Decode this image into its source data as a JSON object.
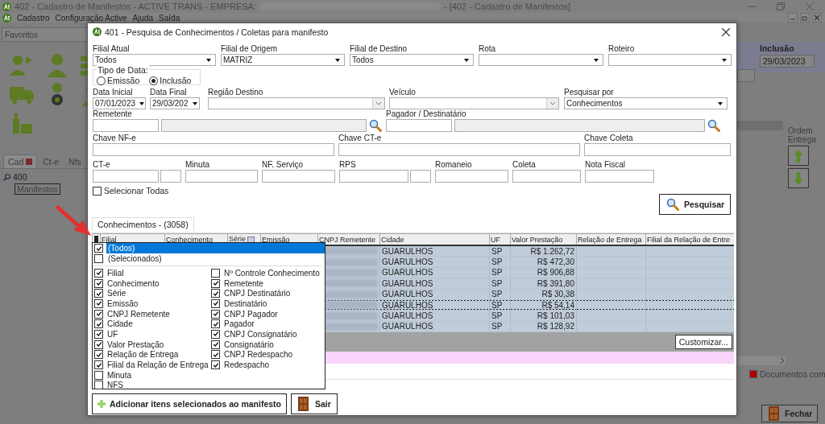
{
  "main_window": {
    "title": "402 - Cadastro de Manifestos - ACTIVE TRANS - EMPRESA:",
    "title_suffix": "- [402 - Cadastro de Manifestos]"
  },
  "menu": [
    "Cadastro",
    "Configuração Active",
    "Ajuda",
    "Saída"
  ],
  "favorites": "Favoritos",
  "side_tabs": [
    {
      "label": "Cad",
      "selected": true
    },
    {
      "label": "Ct-e",
      "selected": false
    },
    {
      "label": "Nfs",
      "selected": false
    }
  ],
  "tree_search": {
    "value": "400"
  },
  "tree": [
    {
      "label": "Manifestos",
      "selected": true
    }
  ],
  "inclusao": {
    "label": "Inclusão",
    "value": "29/03/2023"
  },
  "ordem_entrega": "Ordem Entrega",
  "legend": {
    "label": "Documentos com",
    "color": "#b00000"
  },
  "close_button": "Fechar",
  "dialog": {
    "title": "401 - Pesquisa de Conhecimentos / Coletas para manifesto",
    "selects": [
      {
        "label": "Filial Atual",
        "value": "Todos"
      },
      {
        "label": "Filial de Origem",
        "value": "MATRIZ"
      },
      {
        "label": "Filial de Destino",
        "value": "Todos"
      },
      {
        "label": "Rota"
      },
      {
        "label": "Roteiro"
      }
    ],
    "date_type": {
      "label": "Tipo de Data:",
      "options": [
        {
          "label": "Emissão",
          "selected": false
        },
        {
          "label": "Inclusão",
          "selected": true
        }
      ]
    },
    "dates": [
      {
        "label": "Data Inicial",
        "value": "07/01/2023"
      },
      {
        "label": "Data Final",
        "value": "29/03/202"
      }
    ],
    "combos": [
      {
        "label": "Região Destino"
      },
      {
        "label": "Veículo"
      },
      {
        "label": "Pesquisar por",
        "value": "Conhecimentos"
      }
    ],
    "lookups": [
      {
        "label": "Remetente"
      },
      {
        "label": "Pagador / Destinatário"
      }
    ],
    "keys": [
      {
        "label": "Chave NF-e"
      },
      {
        "label": "Chave CT-e"
      },
      {
        "label": "Chave Coleta"
      }
    ],
    "numbers": [
      {
        "label": "CT-e",
        "split": true
      },
      {
        "label": "Minuta",
        "split": false
      },
      {
        "label": "NF. Serviço",
        "split": false
      },
      {
        "label": "RPS",
        "split": true
      },
      {
        "label": "Romaneio",
        "split": false
      },
      {
        "label": "Coleta",
        "split": false
      },
      {
        "label": "Nota Fiscal",
        "split": false
      }
    ],
    "select_all": {
      "label": "Selecionar Todas",
      "checked": false
    },
    "search_button": "Pesquisar",
    "results_tab": {
      "label": "Conhecimentos - (3058)",
      "selected": true
    },
    "columns": [
      {
        "label": "Filial",
        "filtered": false
      },
      {
        "label": "Conhecimento",
        "filtered": false
      },
      {
        "label": "Série",
        "filtered": true
      },
      {
        "label": "Emissão",
        "filtered": false
      },
      {
        "label": "CNPJ Remetente",
        "filtered": false
      },
      {
        "label": "Cidade",
        "filtered": false
      },
      {
        "label": "UF",
        "filtered": false
      },
      {
        "label": "Valor Prestação",
        "filtered": false
      },
      {
        "label": "Relação de Entrega",
        "filtered": false
      },
      {
        "label": "Filial da Relação de Entre",
        "filtered": false
      }
    ],
    "rows": [
      {
        "cidade": "GUARULHOS",
        "uf": "SP",
        "valor": "R$ 1.262,72",
        "focused": false
      },
      {
        "cidade": "GUARULHOS",
        "uf": "SP",
        "valor": "R$ 472,30",
        "focused": false
      },
      {
        "cidade": "GUARULHOS",
        "uf": "SP",
        "valor": "R$ 906,88",
        "focused": false
      },
      {
        "cidade": "GUARULHOS",
        "uf": "SP",
        "valor": "R$ 391,80",
        "focused": false
      },
      {
        "cidade": "GUARULHOS",
        "uf": "SP",
        "valor": "R$ 30,38",
        "focused": false
      },
      {
        "cidade": "GUARULHOS",
        "uf": "SP",
        "valor": "R$ 54,14",
        "focused": true
      },
      {
        "cidade": "GUARULHOS",
        "uf": "SP",
        "valor": "R$ 101,03",
        "focused": false
      },
      {
        "cidade": "GUARULHOS",
        "uf": "SP",
        "valor": "R$ 128,92",
        "focused": false
      }
    ],
    "customize_button": "Customizar...",
    "column_chooser": {
      "special": [
        {
          "label": "(Todos)",
          "checked": true,
          "selected": true
        },
        {
          "label": "(Selecionados)",
          "checked": false,
          "selected": false
        }
      ],
      "items": [
        {
          "label": "Filial",
          "checked": true
        },
        {
          "label": "Conhecimento",
          "checked": true
        },
        {
          "label": "Série",
          "checked": true
        },
        {
          "label": "Emissão",
          "checked": true
        },
        {
          "label": "CNPJ Remetente",
          "checked": true
        },
        {
          "label": "Cidade",
          "checked": true
        },
        {
          "label": "UF",
          "checked": true
        },
        {
          "label": "Valor Prestação",
          "checked": true
        },
        {
          "label": "Relação de Entrega",
          "checked": true
        },
        {
          "label": "Filial da Relação de Entrega",
          "checked": true
        },
        {
          "label": "Minuta",
          "checked": false
        },
        {
          "label": "NFS",
          "checked": false
        },
        {
          "label": "Nº Controle Conhecimento",
          "checked": false
        },
        {
          "label": "Remetente",
          "checked": true
        },
        {
          "label": "CNPJ Destinatário",
          "checked": true
        },
        {
          "label": "Destinatário",
          "checked": true
        },
        {
          "label": "CNPJ Pagador",
          "checked": true
        },
        {
          "label": "Pagador",
          "checked": true
        },
        {
          "label": "CNPJ Consignatário",
          "checked": true
        },
        {
          "label": "Consignatário",
          "checked": true
        },
        {
          "label": "CNPJ Redespacho",
          "checked": true
        },
        {
          "label": "Redespacho",
          "checked": true
        }
      ]
    },
    "buttons": [
      {
        "label": "Adicionar itens selecionados ao manifesto",
        "kind": "add"
      },
      {
        "label": "Sair",
        "kind": "exit"
      }
    ]
  }
}
